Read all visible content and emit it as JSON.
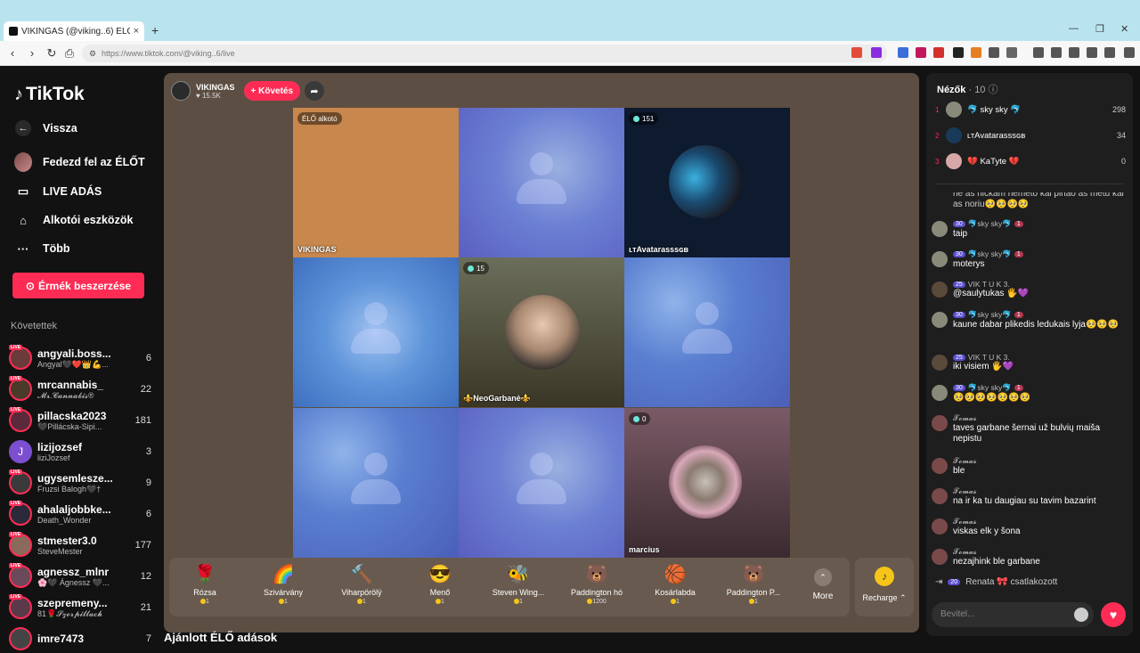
{
  "browser": {
    "tab_title": "VIKINGAS (@viking..6) ÉLŐ adás",
    "tab_close": "×",
    "new_tab": "+",
    "url": "https://www.tiktok.com/@viking..6/live"
  },
  "sidebar": {
    "logo": "TikTok",
    "nav": [
      {
        "label": "Vissza",
        "icon": "back-arrow-icon"
      },
      {
        "label": "Fedezd fel az ÉLŐT",
        "icon": "avatar-icon"
      },
      {
        "label": "LIVE ADÁS",
        "icon": "video-camera-icon"
      },
      {
        "label": "Alkotói eszközök",
        "icon": "home-icon"
      },
      {
        "label": "Több",
        "icon": "more-dots-icon"
      }
    ],
    "coins_button": "Érmék beszerzése",
    "following_title": "Követettek",
    "following": [
      {
        "name": "angyali.boss...",
        "sub": "Angyal🖤❤️👑💪...",
        "count": "6"
      },
      {
        "name": "mrcannabis_",
        "sub": "𝓜𝓻.𝓒𝓪𝓷𝓷𝓪𝓫𝓲𝓼®",
        "count": "22"
      },
      {
        "name": "pillacska2023",
        "sub": "🖤Pillácska-Sipi...",
        "count": "181"
      },
      {
        "name": "lizijozsef",
        "sub": "liziJozsef",
        "count": "3"
      },
      {
        "name": "ugysemlesze...",
        "sub": "Fruzsi Balogh🖤†",
        "count": "9"
      },
      {
        "name": "ahalaljobbke...",
        "sub": "Death_Wonder",
        "count": "6"
      },
      {
        "name": "stmester3.0",
        "sub": "SteveMester",
        "count": "177"
      },
      {
        "name": "agnessz_mlnr",
        "sub": "🌸🖤 Ágnessz 🖤...",
        "count": "12"
      },
      {
        "name": "szepremeny...",
        "sub": "81🌹𝓢𝔃𝓸𝓻𝓹𝓲𝓵𝓵𝓪𝓬𝓱",
        "count": "21"
      },
      {
        "name": "imre7473",
        "sub": "",
        "count": "7"
      }
    ]
  },
  "main": {
    "host_name": "VIKINGAS",
    "host_likes": "♥ 15.5K",
    "follow_button": "+ Követés",
    "share_icon": "➦",
    "cells": [
      {
        "badge": "ÉLŐ alkotó",
        "name": "VIKINGAS"
      },
      {
        "badge": "151",
        "name": "ʟᴛAvatarasssɢʙ"
      },
      {
        "badge": "15",
        "name": "⚜️NeoGarbanė⚜️"
      },
      {
        "badge": "0",
        "name": "marcius"
      }
    ],
    "gifts": [
      {
        "name": "Rózsa",
        "price": "1",
        "icon": "🌹"
      },
      {
        "name": "Szivárvány",
        "price": "1",
        "icon": "🌈"
      },
      {
        "name": "Viharpörölÿ",
        "price": "1",
        "icon": "🔨"
      },
      {
        "name": "Menő",
        "price": "1",
        "icon": "😎"
      },
      {
        "name": "Steven Wing...",
        "price": "1",
        "icon": "🐝"
      },
      {
        "name": "Paddington hó",
        "price": "1200",
        "icon": "🐻"
      },
      {
        "name": "Kosárlabda",
        "price": "1",
        "icon": "🏀"
      },
      {
        "name": "Paddington P...",
        "price": "1",
        "icon": "🐻"
      }
    ],
    "more_label": "More",
    "recharge_label": "Recharge ⌃",
    "recommended": "Ajánlott ÉLŐ adások"
  },
  "right": {
    "viewers_label": "Nézők",
    "viewers_count": "· 10",
    "ranking": [
      {
        "rank": "1",
        "name": "🐬 sky sky 🐬",
        "score": "298"
      },
      {
        "rank": "2",
        "name": "ʟᴛAvatarasssɢʙ",
        "score": "34"
      },
      {
        "rank": "3",
        "name": "💔 KaTyte 💔",
        "score": "0"
      }
    ],
    "messages": [
      {
        "head": "",
        "text": "ne as nickam nemeto kai pinao as metu kai as noriu🥺🥺🥺🥺"
      },
      {
        "head": "🐬sky sky🐬",
        "lvl": "30",
        "lvl2": "1",
        "text": "taip"
      },
      {
        "head": "🐬sky sky🐬",
        "lvl": "30",
        "lvl2": "1",
        "text": "moterys"
      },
      {
        "head": "VIK  T U K   3.",
        "lvl": "25",
        "lvl2": "",
        "text": "@saulytukas 🖐️💜"
      },
      {
        "head": "🐬sky sky🐬",
        "lvl": "30",
        "lvl2": "1",
        "text": "kaune dabar plikedis ledukais lyja🥺🥺🥺"
      },
      {
        "head": "VIK  T U K   3.",
        "lvl": "25",
        "lvl2": "",
        "text": "iki visiem 🖐️💜"
      },
      {
        "head": "🐬sky sky🐬",
        "lvl": "30",
        "lvl2": "1",
        "text": "🥺🥺🥺🥺🥺🥺🥺"
      },
      {
        "head": "𝓣𝓸𝓶𝓪𝓼",
        "lvl": "",
        "lvl2": "",
        "text": "taves garbane šernai už bulvių maiša nepistu"
      },
      {
        "head": "𝓣𝓸𝓶𝓪𝓼",
        "lvl": "",
        "lvl2": "",
        "text": "ble"
      },
      {
        "head": "𝓣𝓸𝓶𝓪𝓼",
        "lvl": "",
        "lvl2": "",
        "text": "na ir ka tu daugiau su tavim bazarint"
      },
      {
        "head": "𝓣𝓸𝓶𝓪𝓼",
        "lvl": "",
        "lvl2": "",
        "text": "viskas elk y šona"
      },
      {
        "head": "𝓣𝓸𝓶𝓪𝓼",
        "lvl": "",
        "lvl2": "",
        "text": "nezajhink ble garbane"
      }
    ],
    "join_lvl": "20",
    "join_text": "Renata 🎀 csatlakozott",
    "input_placeholder": "Bevitel..."
  }
}
